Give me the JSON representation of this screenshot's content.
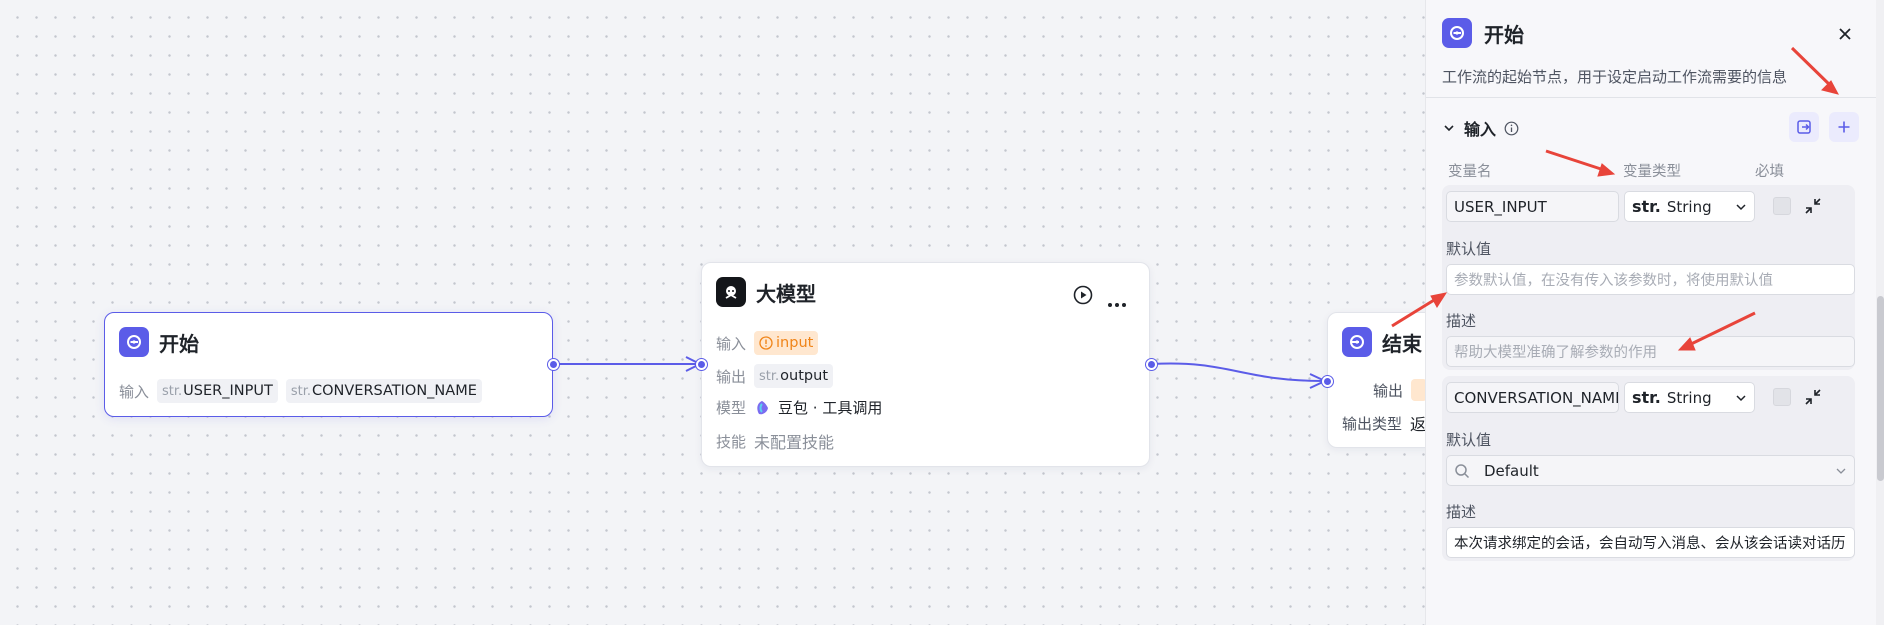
{
  "canvas": {
    "start_node": {
      "title": "开始",
      "input_label": "输入",
      "tags": [
        {
          "prefix": "str.",
          "name": "USER_INPUT"
        },
        {
          "prefix": "str.",
          "name": "CONVERSATION_NAME"
        }
      ]
    },
    "llm_node": {
      "title": "大模型",
      "input_label": "输入",
      "input_tag": "input",
      "output_label": "输出",
      "output_prefix": "str.",
      "output_name": "output",
      "model_label": "模型",
      "model_value": "豆包 · 工具调用",
      "skill_label": "技能",
      "skill_value": "未配置技能"
    },
    "end_node": {
      "title": "结束",
      "output_label": "输出",
      "output_type_label": "输出类型",
      "output_type_value": "返"
    }
  },
  "panel": {
    "title": "开始",
    "description": "工作流的起始节点，用于设定启动工作流需要的信息",
    "section_title": "输入",
    "columns": {
      "name": "变量名",
      "type": "变量类型",
      "required": "必填"
    },
    "variables": [
      {
        "name": "USER_INPUT",
        "type_prefix": "str.",
        "type": "String",
        "default_label": "默认值",
        "default_placeholder": "参数默认值，在没有传入该参数时，将使用默认值",
        "desc_label": "描述",
        "desc_placeholder": "帮助大模型准确了解参数的作用"
      },
      {
        "name": "CONVERSATION_NAME",
        "type_prefix": "str.",
        "type": "String",
        "default_label": "默认值",
        "default_value": "Default",
        "desc_label": "描述",
        "desc_value": "本次请求绑定的会话，会自动写入消息、会从该会话读对话历"
      }
    ]
  },
  "colors": {
    "accent": "#5b5ce8",
    "annotation_arrow": "#e8443a",
    "warn": "#f08418"
  }
}
